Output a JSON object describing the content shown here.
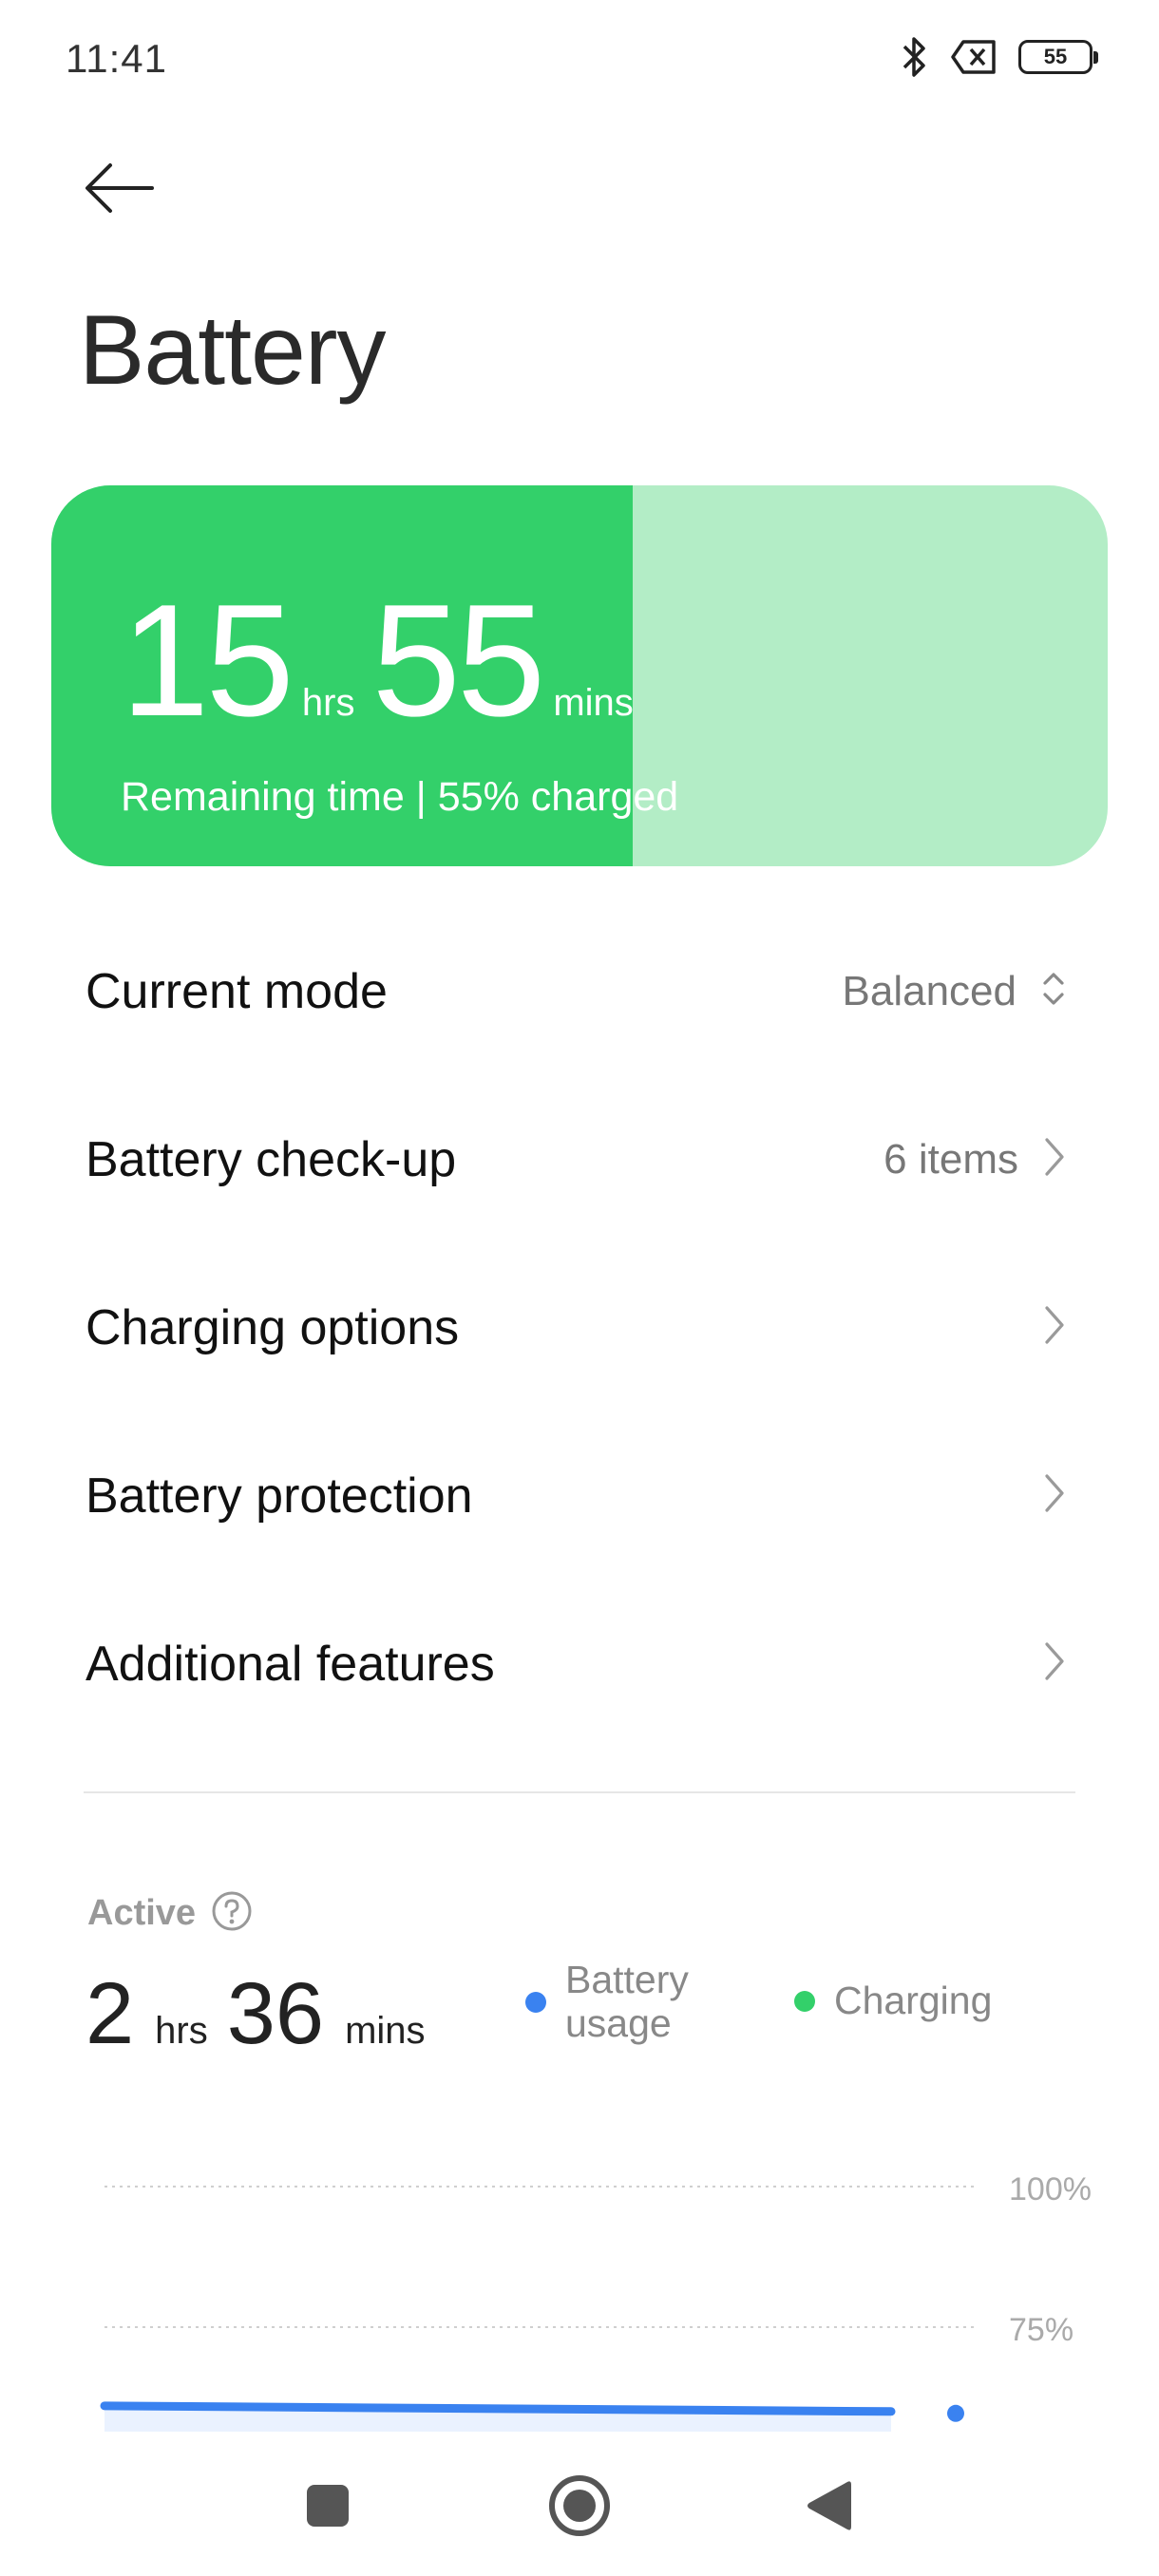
{
  "status_bar": {
    "time": "11:41",
    "battery_level": "55",
    "icons": [
      "bluetooth-icon",
      "no-sim-icon",
      "battery-icon"
    ]
  },
  "header": {
    "back_icon": "arrow-left-icon",
    "title": "Battery"
  },
  "battery_card": {
    "hours": "15",
    "hours_unit": "hrs",
    "minutes": "55",
    "minutes_unit": "mins",
    "subtitle": "Remaining time | 55% charged",
    "charge_fraction": 0.55,
    "fill_color": "#33d06a",
    "track_color": "#b3edc6"
  },
  "settings": {
    "items": [
      {
        "label": "Current mode",
        "value": "Balanced",
        "icon": "up-down-chevron-icon"
      },
      {
        "label": "Battery check-up",
        "value": "6 items",
        "icon": "chevron-right-icon"
      },
      {
        "label": "Charging options",
        "value": "",
        "icon": "chevron-right-icon"
      },
      {
        "label": "Battery protection",
        "value": "",
        "icon": "chevron-right-icon"
      },
      {
        "label": "Additional features",
        "value": "",
        "icon": "chevron-right-icon"
      }
    ]
  },
  "usage": {
    "active_label": "Active",
    "help_icon": "help-icon",
    "hours": "2",
    "hours_unit": "hrs",
    "minutes": "36",
    "minutes_unit": "mins",
    "legend": {
      "battery_usage": "Battery usage",
      "battery_usage_line1": "Battery",
      "battery_usage_line2": "usage",
      "charging": "Charging",
      "battery_color": "#3a82f0",
      "charging_color": "#33d06a"
    },
    "chart_labels": {
      "y100": "100%",
      "y75": "75%"
    }
  },
  "nav_bar": {
    "items": [
      "recents-icon",
      "home-icon",
      "back-icon"
    ]
  },
  "chart_data": {
    "type": "line",
    "title": "",
    "series": [
      {
        "values": [
          61,
          60
        ]
      }
    ],
    "x": [
      0,
      1
    ],
    "ylabel": "",
    "ylim": [
      50,
      100
    ],
    "yticks": [
      "100%",
      "75%"
    ]
  }
}
